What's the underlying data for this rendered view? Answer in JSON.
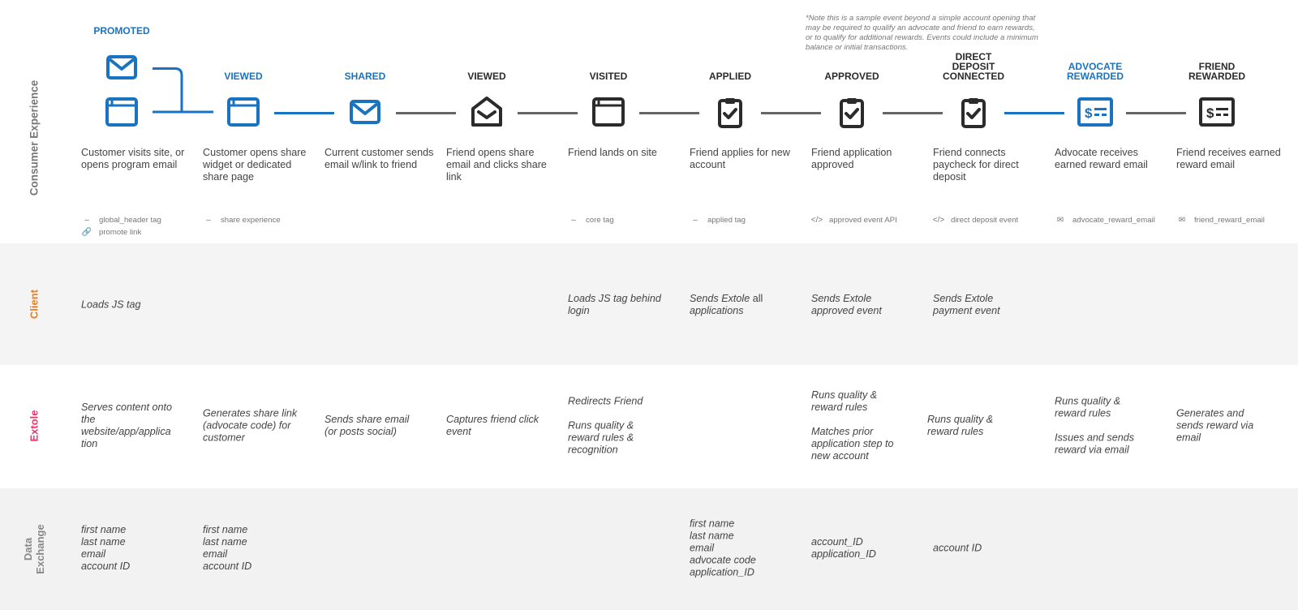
{
  "lanes": {
    "consumer_experience": "Consumer Experience",
    "client": "Client",
    "extole": "Extole",
    "data_exchange_line1": "Data",
    "data_exchange_line2": "Exchange"
  },
  "colors": {
    "blue": "#1a73c0",
    "dark": "#2b2b2b",
    "client": "#e67e22",
    "extole": "#e8336b"
  },
  "note": "*Note this is a sample event beyond a simple account opening that may be required to qualify an advocate and friend to earn rewards, or to qualify for additional rewards. Events could include a minimum balance or initial transactions.",
  "steps": [
    {
      "title": "PROMOTED",
      "color": "blue",
      "icons": [
        "email-icon",
        "browser-window-icon"
      ],
      "description": "Customer visits site, or opens program email",
      "tags": [
        {
          "icon": "tag-dash-icon",
          "label": "global_header tag"
        },
        {
          "icon": "link-icon",
          "label": "promote link"
        }
      ]
    },
    {
      "title": "VIEWED",
      "color": "blue",
      "icons": [
        "browser-window-icon"
      ],
      "description": "Customer opens share widget or dedicated share page",
      "tags": [
        {
          "icon": "tag-dash-icon",
          "label": "share experience"
        }
      ]
    },
    {
      "title": "SHARED",
      "color": "blue",
      "icons": [
        "email-icon"
      ],
      "description": "Current customer sends email w/link to friend",
      "tags": []
    },
    {
      "title": "VIEWED",
      "color": "dark",
      "icons": [
        "open-email-icon"
      ],
      "description": "Friend opens share email and clicks share link",
      "tags": []
    },
    {
      "title": "VISITED",
      "color": "dark",
      "icons": [
        "browser-window-icon"
      ],
      "description": "Friend lands on site",
      "tags": [
        {
          "icon": "tag-dash-icon",
          "label": "core tag"
        }
      ]
    },
    {
      "title": "APPLIED",
      "color": "dark",
      "icons": [
        "clipboard-check-icon"
      ],
      "description": "Friend applies for new account",
      "tags": [
        {
          "icon": "tag-dash-icon",
          "label": "applied tag"
        }
      ]
    },
    {
      "title": "APPROVED",
      "color": "dark",
      "icons": [
        "clipboard-check-icon"
      ],
      "description": "Friend application approved",
      "tags": [
        {
          "icon": "code-icon",
          "label": "approved event API"
        }
      ]
    },
    {
      "title_lines": [
        "DIRECT",
        "DEPOSIT",
        "CONNECTED"
      ],
      "title": "DIRECT DEPOSIT CONNECTED",
      "color": "dark",
      "icons": [
        "clipboard-check-icon"
      ],
      "description": "Friend connects paycheck for direct deposit",
      "tags": [
        {
          "icon": "code-icon",
          "label": "direct deposit event"
        }
      ]
    },
    {
      "title_lines": [
        "ADVOCATE",
        "REWARDED"
      ],
      "title": "ADVOCATE REWARDED",
      "color": "blue",
      "icons": [
        "reward-card-icon"
      ],
      "description": "Advocate receives earned reward email",
      "tags": [
        {
          "icon": "envelope-icon",
          "label": "advocate_reward_email"
        }
      ]
    },
    {
      "title_lines": [
        "FRIEND",
        "REWARDED"
      ],
      "title": "FRIEND REWARDED",
      "color": "dark",
      "icons": [
        "reward-card-icon"
      ],
      "description": "Friend receives earned reward email",
      "tags": [
        {
          "icon": "envelope-icon",
          "label": "friend_reward_email"
        }
      ]
    }
  ],
  "client_row": [
    {
      "col": 0,
      "lines": [
        "Loads JS tag"
      ]
    },
    {
      "col": 4,
      "lines": [
        "Loads JS tag behind",
        "login"
      ]
    },
    {
      "col": 5,
      "lines_rich": [
        [
          "Sends Extole",
          " all"
        ],
        [
          "applications",
          ""
        ]
      ]
    },
    {
      "col": 6,
      "lines": [
        "Sends Extole",
        "approved event"
      ]
    },
    {
      "col": 7,
      "lines": [
        "Sends Extole",
        "payment event"
      ]
    }
  ],
  "extole_row": [
    {
      "col": 0,
      "lines": [
        "Serves content onto",
        "the",
        "website/app/applica",
        "tion"
      ]
    },
    {
      "col": 1,
      "lines": [
        "Generates share link",
        "(advocate code) for",
        "customer"
      ]
    },
    {
      "col": 2,
      "lines": [
        "Sends share email",
        "(or posts social)"
      ]
    },
    {
      "col": 3,
      "lines": [
        "Captures friend click",
        "event"
      ]
    },
    {
      "col": 4,
      "lines": [
        "Redirects Friend",
        "",
        "Runs quality &",
        "reward rules &",
        "recognition"
      ]
    },
    {
      "col": 6,
      "lines": [
        "Runs quality &",
        "reward rules",
        "",
        "Matches prior",
        "application step to",
        "new account"
      ]
    },
    {
      "col": 7,
      "lines": [
        "Runs quality &",
        "reward rules"
      ]
    },
    {
      "col": 8,
      "lines": [
        "Runs quality &",
        "reward rules",
        "",
        "Issues and sends",
        "reward via email"
      ]
    },
    {
      "col": 9,
      "lines": [
        "Generates and",
        "sends reward via",
        "email"
      ]
    }
  ],
  "data_row": [
    {
      "col": 0,
      "lines": [
        "first name",
        "last name",
        "email",
        "account ID"
      ]
    },
    {
      "col": 1,
      "lines": [
        "first name",
        "last name",
        "email",
        "account ID"
      ]
    },
    {
      "col": 5,
      "lines": [
        "first name",
        "last name",
        "email",
        "advocate code",
        "application_ID"
      ]
    },
    {
      "col": 6,
      "lines": [
        "account_ID",
        "application_ID"
      ]
    },
    {
      "col": 7,
      "lines": [
        "account ID"
      ]
    }
  ]
}
